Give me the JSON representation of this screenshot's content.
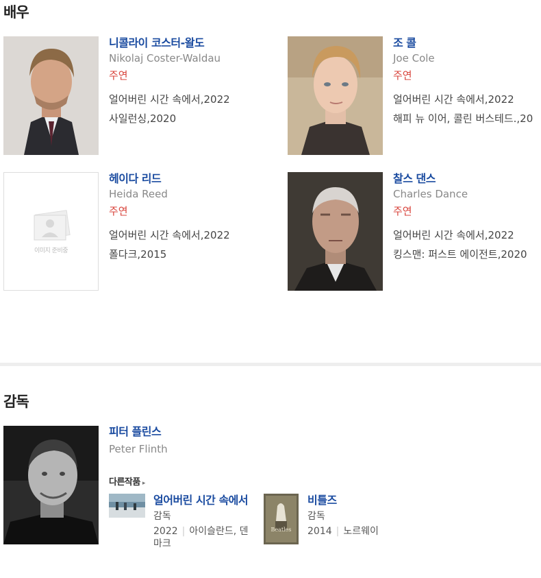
{
  "actors_section": {
    "title": "배우"
  },
  "actors": [
    {
      "name_ko": "니콜라이 코스터-왈도",
      "name_en": "Nikolaj Coster-Waldau",
      "role": "주연",
      "works": [
        "얼어버린 시간 속에서,2022",
        "사일런싱,2020"
      ]
    },
    {
      "name_ko": "조 콜",
      "name_en": "Joe Cole",
      "role": "주연",
      "works": [
        "얼어버린 시간 속에서,2022",
        "해피 뉴 이어, 콜린 버스테드.,20"
      ]
    },
    {
      "name_ko": "헤이다 리드",
      "name_en": "Heida Reed",
      "role": "주연",
      "works": [
        "얼어버린 시간 속에서,2022",
        "폴다크,2015"
      ],
      "placeholder_text": "이미지 준비중"
    },
    {
      "name_ko": "찰스 댄스",
      "name_en": "Charles Dance",
      "role": "주연",
      "works": [
        "얼어버린 시간 속에서,2022",
        "킹스맨: 퍼스트 에이전트,2020"
      ]
    }
  ],
  "director_section": {
    "title": "감독"
  },
  "director": {
    "name_ko": "피터 플린스",
    "name_en": "Peter Flinth",
    "other_works_label": "다른작품",
    "other_works": [
      {
        "title": "얼어버린 시간 속에서",
        "role": "감독",
        "year": "2022",
        "country": "아이슬란드, 덴마크"
      },
      {
        "title": "비틀즈",
        "role": "감독",
        "year": "2014",
        "country": "노르웨이",
        "poster_text": "Beatles"
      }
    ]
  }
}
